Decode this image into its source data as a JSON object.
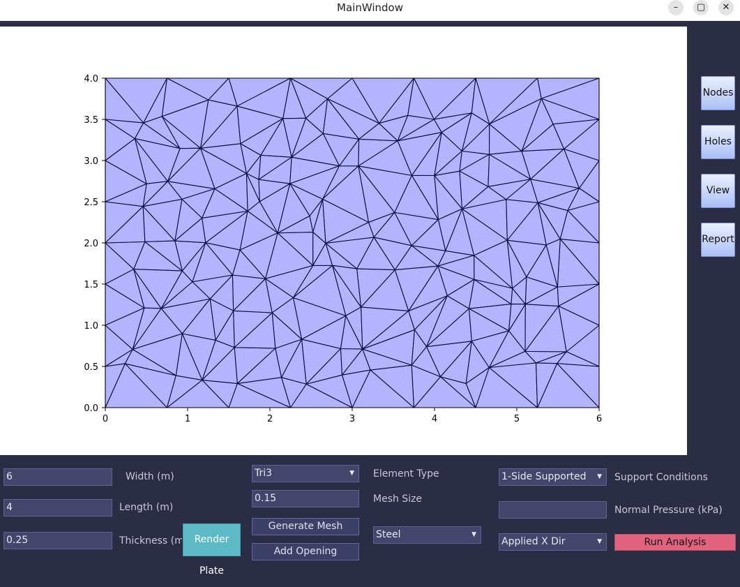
{
  "window": {
    "title": "MainWindow",
    "minimize_icon": "minimize-icon",
    "maximize_icon": "maximize-icon",
    "close_icon": "close-icon",
    "minimize_glyph": "–",
    "maximize_glyph": "▢",
    "close_glyph": "✕"
  },
  "sidebar": {
    "buttons": [
      "Nodes",
      "Holes",
      "View",
      "Report"
    ]
  },
  "plot": {
    "x_ticks": [
      "0",
      "1",
      "2",
      "3",
      "4",
      "5",
      "6"
    ],
    "y_ticks": [
      "0.0",
      "0.5",
      "1.0",
      "1.5",
      "2.0",
      "2.5",
      "3.0",
      "3.5",
      "4.0"
    ],
    "fill_color": "#b3b3ff",
    "edge_color": "#0a0a40"
  },
  "chart_data": {
    "type": "mesh",
    "xlim": [
      0,
      6
    ],
    "ylim": [
      0,
      4
    ],
    "grid": false
  },
  "controls": {
    "width_value": "6",
    "width_label": "Width (m)",
    "length_value": "4",
    "length_label": "Length (m)",
    "thickness_value": "0.25",
    "thickness_label": "Thickness (m",
    "render_button": "Render Plate",
    "element_type_value": "Tri3",
    "element_type_label": "Element Type",
    "mesh_size_value": "0.15",
    "mesh_size_label": "Mesh Size",
    "generate_mesh_button": "Generate Mesh",
    "add_opening_button": "Add Opening",
    "material_value": "Steel",
    "support_value": "1-Side Supported",
    "support_label": "Support Conditions",
    "pressure_value": "",
    "pressure_label": "Normal Pressure (kPa)",
    "direction_value": "Applied X Dir",
    "run_button": "Run Analysis"
  }
}
